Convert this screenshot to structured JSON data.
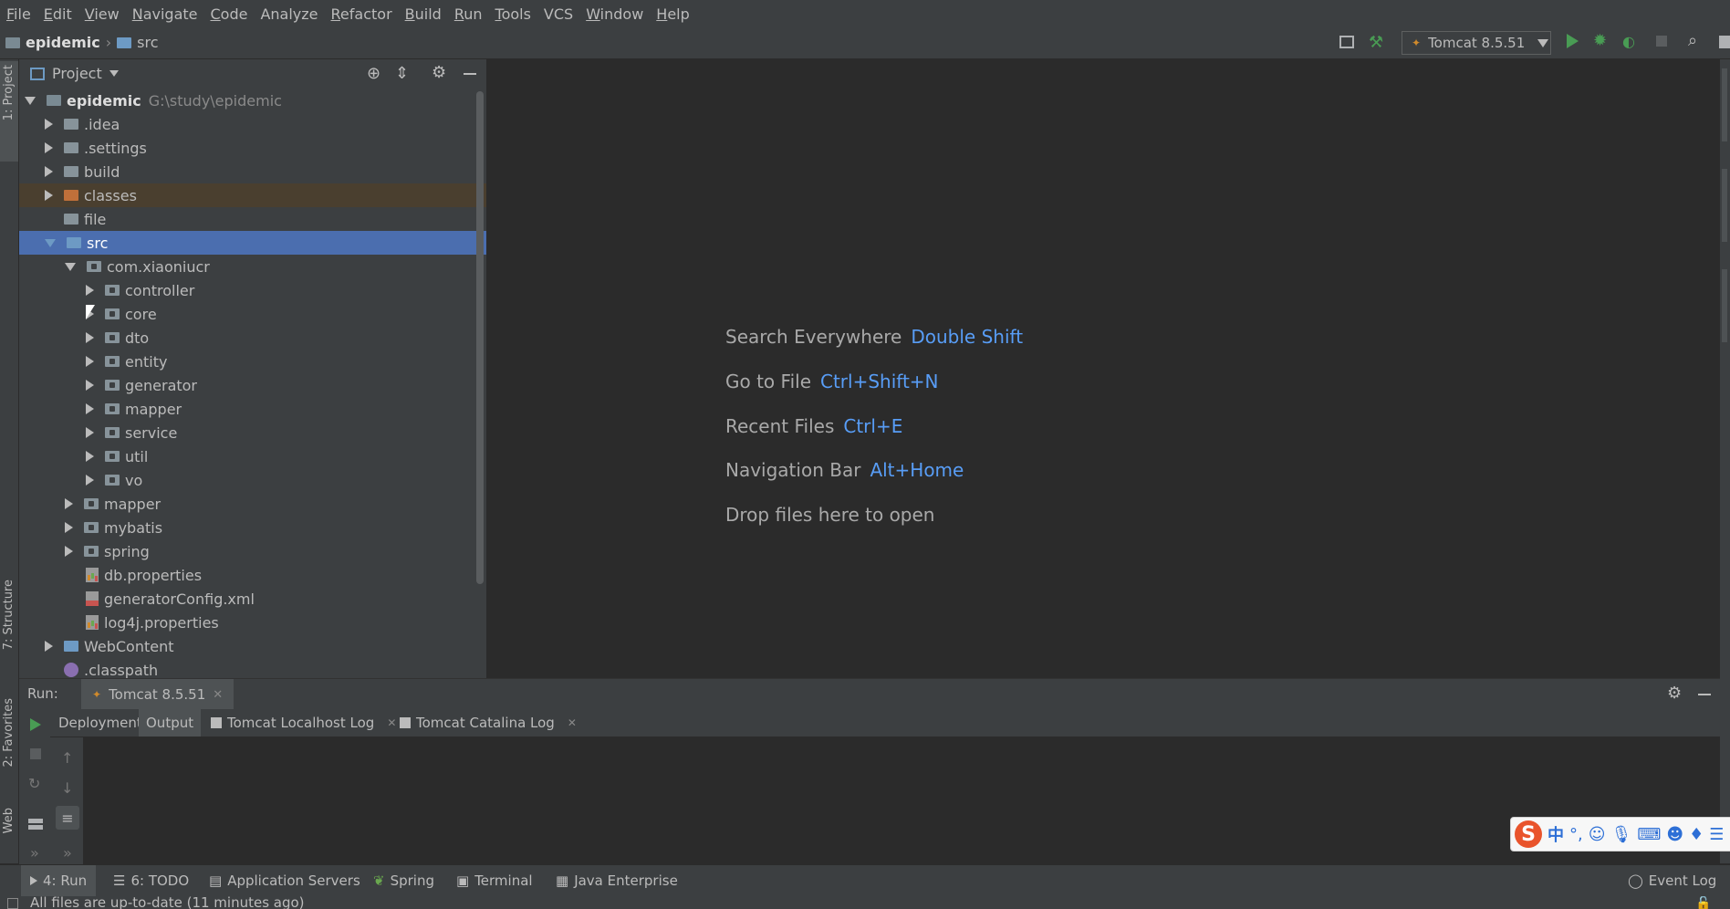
{
  "menu": [
    {
      "label": "File",
      "mn": "F",
      "rest": "ile"
    },
    {
      "label": "Edit",
      "mn": "E",
      "rest": "dit"
    },
    {
      "label": "View",
      "mn": "V",
      "rest": "iew"
    },
    {
      "label": "Navigate",
      "mn": "N",
      "rest": "avigate"
    },
    {
      "label": "Code",
      "mn": "C",
      "rest": "ode"
    },
    {
      "label": "Analyze",
      "mn": "",
      "rest": "Analyze"
    },
    {
      "label": "Refactor",
      "mn": "R",
      "rest": "efactor"
    },
    {
      "label": "Build",
      "mn": "B",
      "rest": "uild"
    },
    {
      "label": "Run",
      "mn": "R",
      "rest": "un"
    },
    {
      "label": "Tools",
      "mn": "T",
      "rest": "ools"
    },
    {
      "label": "VCS",
      "mn": "",
      "rest": "VCS"
    },
    {
      "label": "Window",
      "mn": "W",
      "rest": "indow"
    },
    {
      "label": "Help",
      "mn": "H",
      "rest": "elp"
    }
  ],
  "breadcrumb": {
    "project": "epidemic",
    "folder": "src"
  },
  "run_config": {
    "label": "Tomcat 8.5.51"
  },
  "left_strip": {
    "project": "1: Project",
    "structure": "7: Structure",
    "favorites": "2: Favorites",
    "web": "Web"
  },
  "project_panel": {
    "title": "Project"
  },
  "tree": {
    "root": {
      "name": "epidemic",
      "path": "G:\\study\\epidemic"
    },
    "idea": ".idea",
    "settings": ".settings",
    "build": "build",
    "classes": "classes",
    "file": "file",
    "src": "src",
    "pkg": "com.xiaoniucr",
    "controller": "controller",
    "core": "core",
    "dto": "dto",
    "entity": "entity",
    "generator": "generator",
    "mapper_pkg": "mapper",
    "service": "service",
    "util": "util",
    "vo": "vo",
    "mapper": "mapper",
    "mybatis": "mybatis",
    "spring": "spring",
    "db_props": "db.properties",
    "gen_config": "generatorConfig.xml",
    "log4j": "log4j.properties",
    "webcontent": "WebContent",
    "classpath": ".classpath"
  },
  "editor_hints": [
    {
      "label": "Search Everywhere",
      "key": "Double Shift"
    },
    {
      "label": "Go to File",
      "key": "Ctrl+Shift+N"
    },
    {
      "label": "Recent Files",
      "key": "Ctrl+E"
    },
    {
      "label": "Navigation Bar",
      "key": "Alt+Home"
    },
    {
      "label": "Drop files here to open",
      "key": ""
    }
  ],
  "run_panel": {
    "label": "Run:",
    "tab": "Tomcat 8.5.51",
    "subtabs": [
      "Deployment",
      "Output",
      "Tomcat Localhost Log",
      "Tomcat Catalina Log"
    ]
  },
  "bottom_tools": [
    {
      "label": "4: Run"
    },
    {
      "label": "6: TODO"
    },
    {
      "label": "Application Servers"
    },
    {
      "label": "Spring"
    },
    {
      "label": "Terminal"
    },
    {
      "label": "Java Enterprise"
    },
    {
      "label": "Event Log"
    }
  ],
  "status": {
    "text": "All files are up-to-date (11 minutes ago)"
  },
  "ime": {
    "logo": "S",
    "lang": "中",
    "punct": "°,"
  },
  "colors": {
    "selection": "#4b6eaf",
    "accent_key": "#589df6",
    "run_green": "#499c54",
    "ime_logo": "#e9542c"
  }
}
